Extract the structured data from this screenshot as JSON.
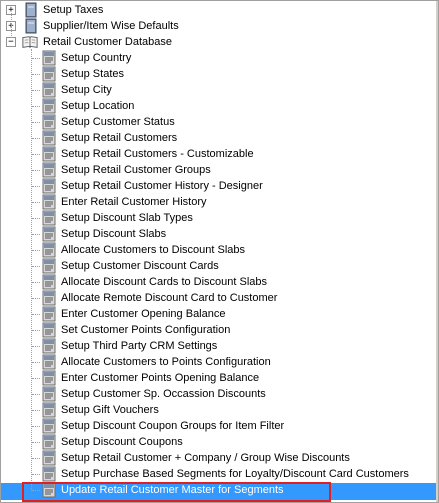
{
  "tree": {
    "top_nodes": [
      {
        "label": "Setup Taxes",
        "expander": "+",
        "icon": "book-closed-icon"
      },
      {
        "label": "Supplier/Item Wise Defaults",
        "expander": "+",
        "icon": "book-closed-icon"
      },
      {
        "label": "Retail Customer Database",
        "expander": "−",
        "icon": "book-open-icon"
      }
    ],
    "children": [
      "Setup Country",
      "Setup States",
      "Setup City",
      "Setup Location",
      "Setup Customer Status",
      "Setup Retail Customers",
      "Setup Retail Customers - Customizable",
      "Setup Retail Customer Groups",
      "Setup Retail Customer History - Designer",
      "Enter Retail Customer History",
      "Setup Discount Slab Types",
      "Setup Discount Slabs",
      "Allocate Customers to Discount Slabs",
      "Setup Customer Discount Cards",
      "Allocate Discount Cards to Discount Slabs",
      "Allocate Remote Discount Card to Customer",
      "Enter Customer Opening Balance",
      "Set Customer Points Configuration",
      "Setup Third Party CRM Settings",
      "Allocate Customers to Points Configuration",
      "Enter Customer Points Opening Balance",
      "Setup Customer Sp. Occassion Discounts",
      "Setup Gift Vouchers",
      "Setup Discount Coupon Groups for Item Filter",
      "Setup Discount Coupons",
      "Setup Retail Customer + Company / Group Wise Discounts",
      "Setup Purchase Based Segments for Loyalty/Discount Card Customers",
      "Update Retail Customer Master for Segments"
    ],
    "selected": "Update Retail Customer Master for Segments",
    "colors": {
      "selection": "#3399ff",
      "highlight_box": "#e02020"
    }
  }
}
